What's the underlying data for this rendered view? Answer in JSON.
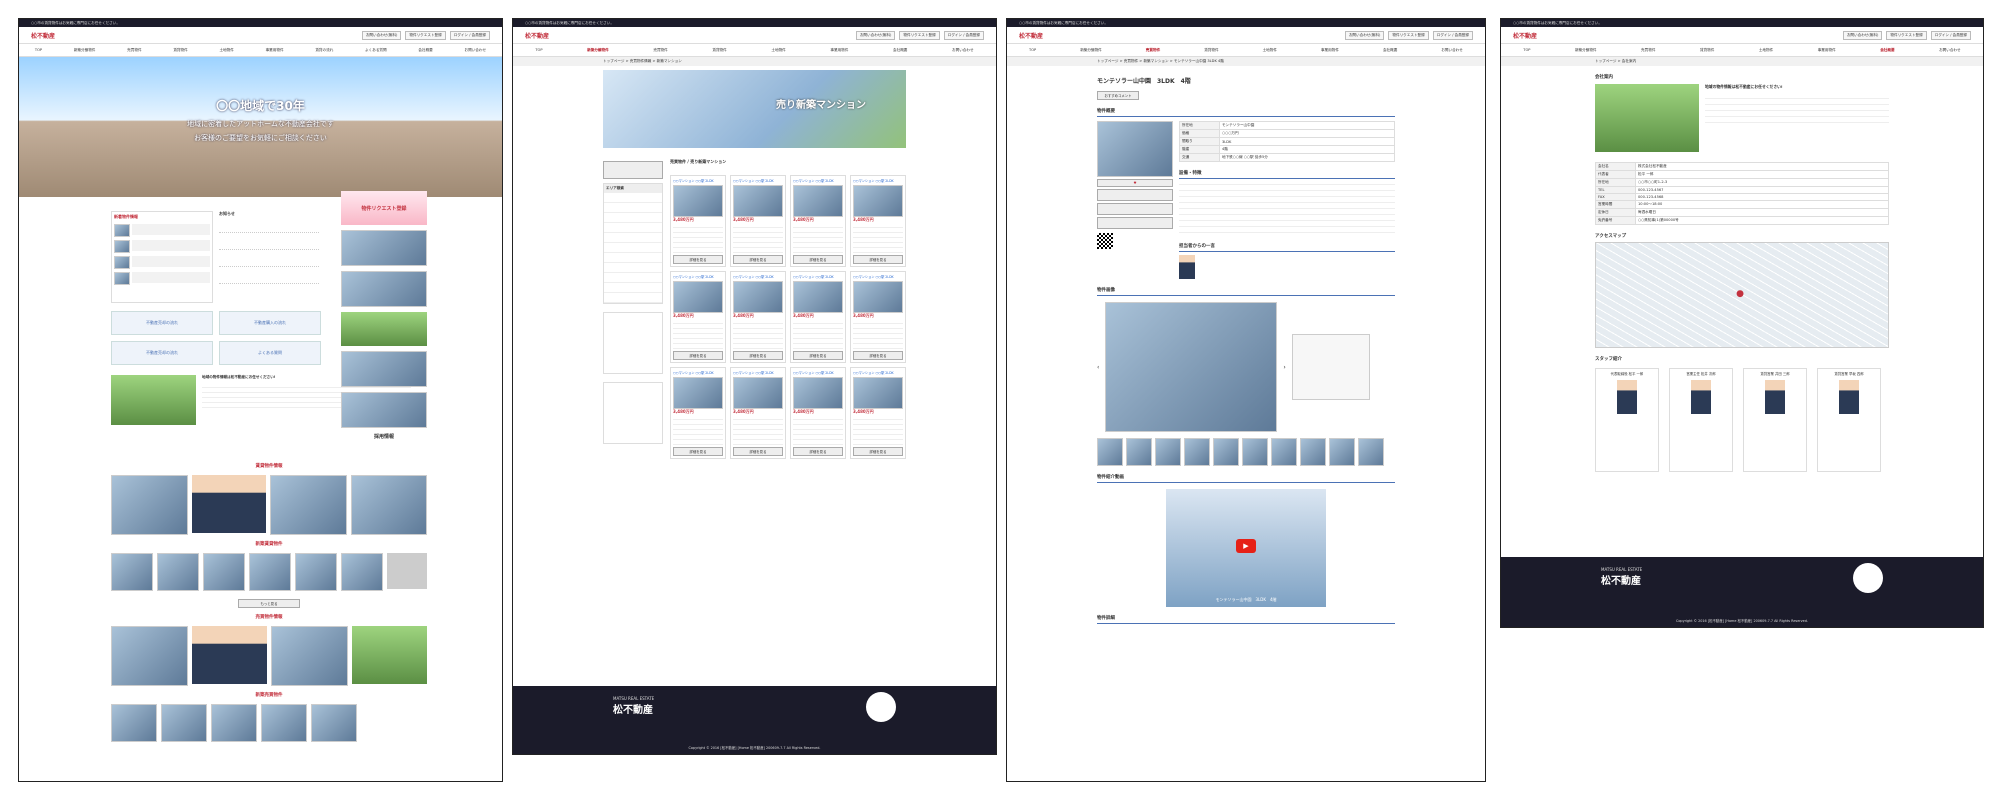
{
  "colors": {
    "accent": "#c3323f",
    "dark": "#1b1b2a",
    "blue": "#4b72b5"
  },
  "common": {
    "topbar": "○○市の賃貸物件はお気軽に専門店にお任せください。",
    "logo": "松不動産",
    "header_links": [
      "お問い合わせ(無料)",
      "物件リクエスト登録",
      "ログイン / 会員登録"
    ],
    "nav": [
      "TOP",
      "新築分譲物件",
      "売買物件",
      "賃貸物件",
      "土地物件",
      "事業用物件",
      "賃貸の流れ",
      "よくある質問",
      "会社概要",
      "お問い合わせ"
    ],
    "footer_logo": "松不動産",
    "footer_brand": "MATSU REAL ESTATE",
    "copyright": "Copyright © 2016 [松不動産] [Home 松不動産] 200609-7.7 All Rights Reserved."
  },
  "panel1": {
    "hero_title": "〇〇地域で30年",
    "hero_line1": "地域に密着したアットホームな不動産会社です",
    "hero_line2": "お客様のご要望をお気軽にご相談ください",
    "section_new": "新着物件情報",
    "section_notice": "お知らせ",
    "request": "物件リクエスト登録",
    "flow1": "不動産売却の流れ",
    "flow2": "不動産購入の流れ",
    "flow3": "不動産売却の流れ",
    "faq": "よくある質問",
    "greeting": "地域の物件情報は松不動産にお任せください!",
    "recruit": "採用情報",
    "rent_title": "賃貸物件情報",
    "new_title": "新築賃貸物件",
    "sale_title": "売買物件情報",
    "new2_title": "新築売買物件",
    "more": "もっと見る"
  },
  "panel2": {
    "breadcrumb": "トップページ > 売買物件情報 > 新築マンション",
    "banner": "売り新築マンション",
    "heading": "売買物件 / 売り新築マンション",
    "side_title": "エリア検索",
    "listing_name": "○○マンション ○○駅 2LDK",
    "listing_price": "3,480万円",
    "detail_button": "詳細を見る"
  },
  "panel3": {
    "breadcrumb": "トップページ > 売買物件 > 新築マンション > モンテソラー山中園 3LDK 4階",
    "title": "モンテソラー山中園　3LDK　4階",
    "recommend": "おすすめコメント",
    "section_info": "物件概要",
    "section_facility": "設備・特徴",
    "section_staff": "担当者からの一言",
    "section_photos": "物件画像",
    "section_video": "物件紹介動画",
    "video_caption": "モンテソラー山中園　3LDK　4階",
    "section_detail": "物件詳細",
    "rows": [
      [
        "所在地",
        "モンテソラー山中園"
      ],
      [
        "価格",
        "○○○万円"
      ],
      [
        "間取り",
        "3LDK"
      ],
      [
        "階建",
        "4階"
      ],
      [
        "交通",
        "地下鉄○○線 ○○駅 徒歩5分"
      ]
    ]
  },
  "panel4": {
    "breadcrumb": "トップページ > 会社案内",
    "section_about": "会社案内",
    "about_head": "地域の物件情報は松不動産にお任せください!",
    "section_access": "アクセスマップ",
    "section_staff": "スタッフ紹介",
    "staff": [
      "代表取締役 松平 一郎",
      "営業主任 松井 次郎",
      "賃貸営業 井田 三郎",
      "賃貸営業 早坂 四郎"
    ],
    "rows": [
      [
        "会社名",
        "株式会社松不動産"
      ],
      [
        "代表者",
        "松平 一郎"
      ],
      [
        "所在地",
        "○○市○○町1-2-3"
      ],
      [
        "TEL",
        "000-123-4567"
      ],
      [
        "FAX",
        "000-123-4568"
      ],
      [
        "営業時間",
        "10:00〜18:00"
      ],
      [
        "定休日",
        "毎週水曜日"
      ],
      [
        "免許番号",
        "○○県知事(1)第00000号"
      ]
    ]
  }
}
